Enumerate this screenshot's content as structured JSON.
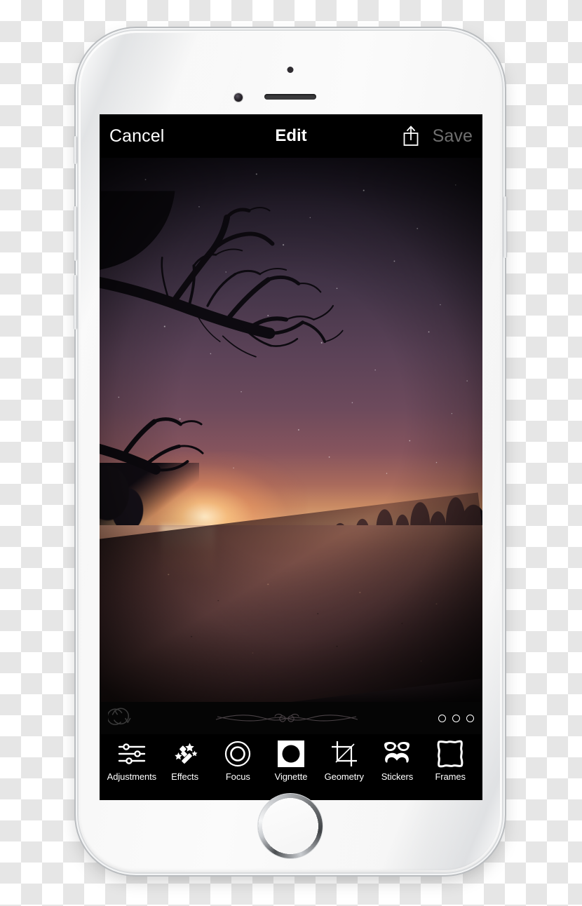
{
  "app": {
    "device": "iPhone",
    "screen_title": "Edit"
  },
  "nav_bar": {
    "cancel_label": "Cancel",
    "title": "Edit",
    "share_icon": "share-icon",
    "save_label": "Save",
    "save_enabled": false,
    "background": "#000000",
    "text_color": "#ffffff",
    "disabled_color": "#6f6f6f"
  },
  "photo": {
    "description": "Night sky sunset over a calm lake with silhouetted tree branches and a rocky shore",
    "vignette_applied": true
  },
  "sub_toolbar": {
    "reset_icon": "reset-rotate-icon",
    "divider_icon": "ornamental-flourish",
    "page_dots": [
      {
        "name": "page-dot-1",
        "active": false
      },
      {
        "name": "page-dot-2",
        "active": false
      },
      {
        "name": "page-dot-3",
        "active": false
      }
    ]
  },
  "tool_bar": {
    "selected": "Vignette",
    "tools": [
      {
        "label": "Adjustments",
        "icon": "sliders-icon",
        "selected": false
      },
      {
        "label": "Effects",
        "icon": "magic-wand-icon",
        "selected": false
      },
      {
        "label": "Focus",
        "icon": "focus-rings-icon",
        "selected": false
      },
      {
        "label": "Vignette",
        "icon": "vignette-icon",
        "selected": true
      },
      {
        "label": "Geometry",
        "icon": "crop-icon",
        "selected": false
      },
      {
        "label": "Stickers",
        "icon": "glasses-mustache-icon",
        "selected": false
      },
      {
        "label": "Frames",
        "icon": "ornate-frame-icon",
        "selected": false
      }
    ]
  },
  "hardware": {
    "earpiece": "earpiece-speaker",
    "front_camera": "front-camera",
    "proximity_sensor": "proximity-sensor",
    "home_button": "home-button",
    "mute_switch": "mute-switch",
    "volume_up": "volume-up-button",
    "volume_down": "volume-down-button",
    "power_button": "power-button"
  }
}
